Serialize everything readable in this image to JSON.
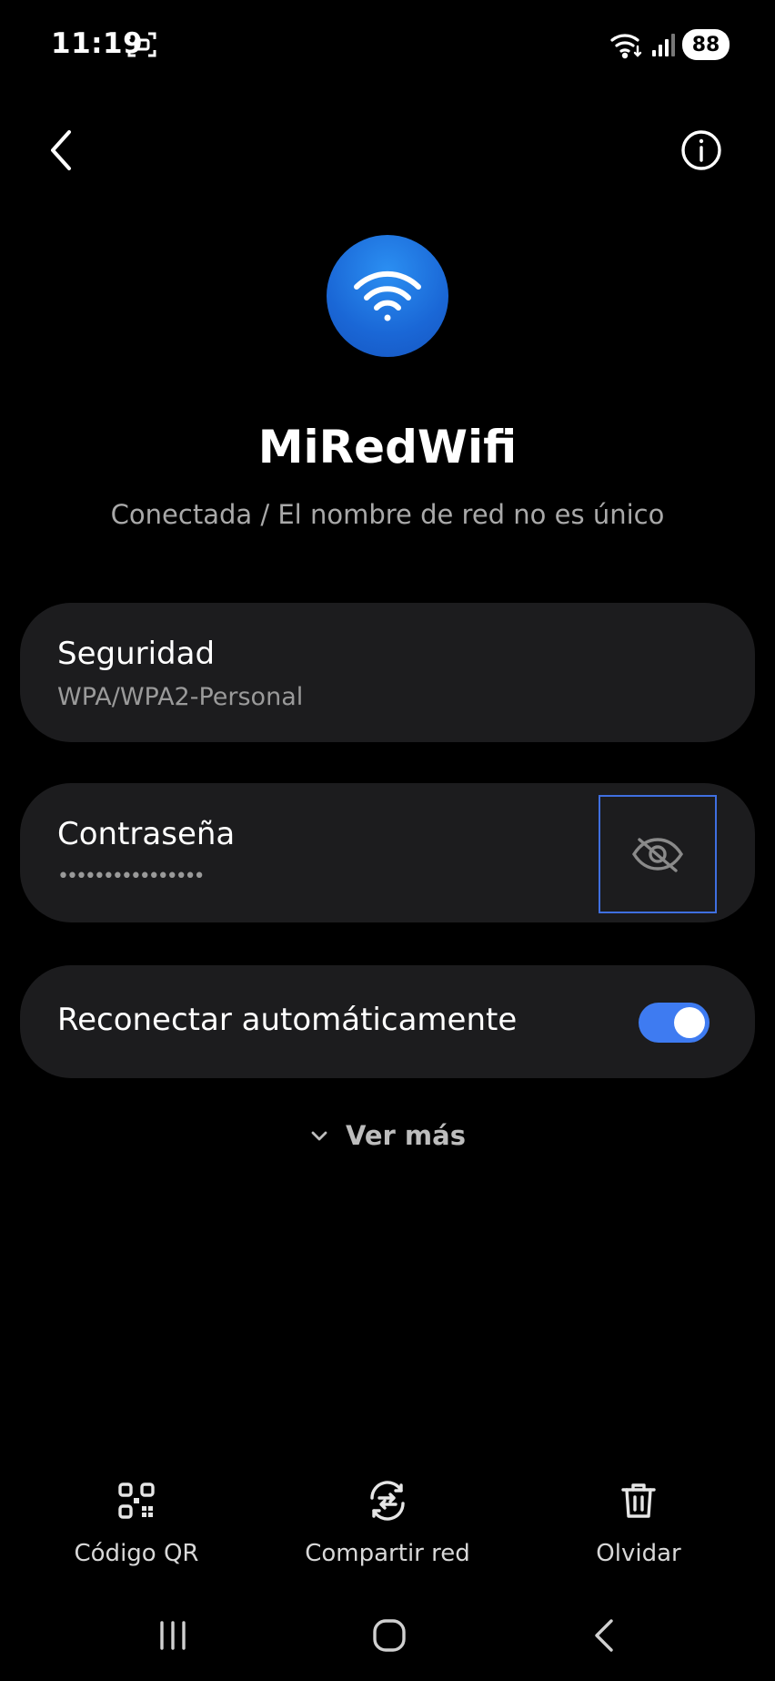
{
  "status_bar": {
    "time": "11:19",
    "battery": "88",
    "icons": [
      "screenshot-icon",
      "wifi-icon",
      "signal-icon"
    ]
  },
  "top_bar": {
    "icons": [
      "back-arrow-icon",
      "info-icon"
    ]
  },
  "network": {
    "icon": "wifi-icon",
    "name": "MiRedWifi",
    "status": "Conectada / El nombre de red no es único"
  },
  "security": {
    "title": "Seguridad",
    "value": "WPA/WPA2-Personal"
  },
  "password": {
    "title": "Contraseña",
    "masked_value": "••••••••••••••••",
    "toggle_icon": "eye-off-icon"
  },
  "reconnect": {
    "title": "Reconectar automáticamente",
    "enabled": true
  },
  "see_more": {
    "label": "Ver más",
    "icon": "chevron-down-icon"
  },
  "actions": [
    {
      "label": "Código QR",
      "icon": "qr-code-icon"
    },
    {
      "label": "Compartir red",
      "icon": "share-network-icon"
    },
    {
      "label": "Olvidar",
      "icon": "trash-icon"
    }
  ],
  "nav_bar": {
    "icons": [
      "recent-apps-icon",
      "home-icon",
      "back-icon"
    ]
  },
  "colors": {
    "accent": "#3e7bf1",
    "card_bg": "#1c1c1e",
    "focus_outline": "#3f6fe0"
  }
}
